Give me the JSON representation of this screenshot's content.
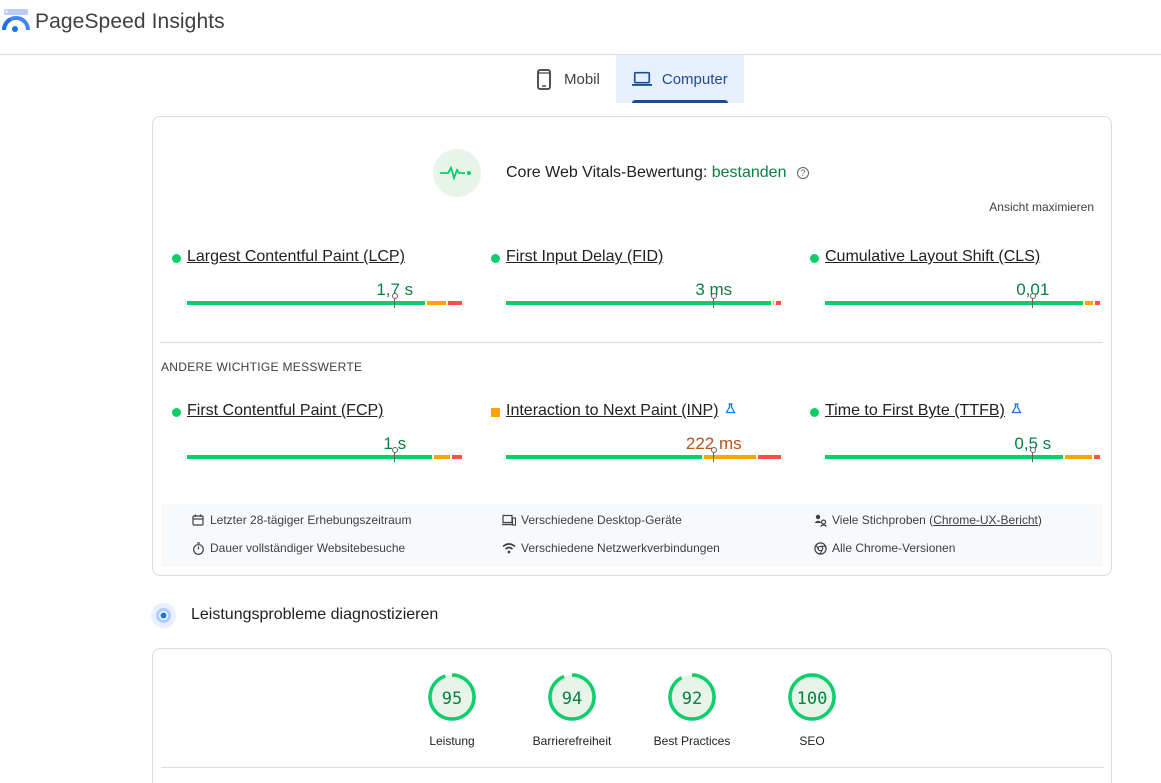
{
  "app": {
    "title": "PageSpeed Insights"
  },
  "tabs": [
    {
      "label": "Mobil",
      "icon": "smartphone-icon",
      "active": false
    },
    {
      "label": "Computer",
      "icon": "laptop-icon",
      "active": true
    }
  ],
  "cwv": {
    "title_prefix": "Core Web Vitals-Bewertung:",
    "status": "bestanden",
    "expand_label": "Ansicht maximieren",
    "core_metrics": [
      {
        "name": "Largest Contentful Paint (LCP)",
        "value": "1,7 s",
        "rating": "good",
        "marker": 0.75,
        "segments": [
          0.867,
          0.075,
          0.058
        ]
      },
      {
        "name": "First Input Delay (FID)",
        "value": "3 ms",
        "rating": "good",
        "marker": 0.75,
        "segments": [
          0.965,
          0.011,
          0.024
        ]
      },
      {
        "name": "Cumulative Layout Shift (CLS)",
        "value": "0,01",
        "rating": "good",
        "marker": 0.75,
        "segments": [
          0.939,
          0.035,
          0.026
        ]
      }
    ],
    "other_label": "ANDERE WICHTIGE MESSWERTE",
    "other_metrics": [
      {
        "name": "First Contentful Paint (FCP)",
        "value": "1 s",
        "rating": "good",
        "marker": 0.75,
        "segments": [
          0.892,
          0.065,
          0.043
        ],
        "experimental": false
      },
      {
        "name": "Interaction to Next Paint (INP)",
        "value": "222 ms",
        "rating": "needs-improvement",
        "marker": 0.75,
        "segments": [
          0.715,
          0.195,
          0.09
        ],
        "experimental": true
      },
      {
        "name": "Time to First Byte (TTFB)",
        "value": "0,5 s",
        "rating": "good",
        "marker": 0.75,
        "segments": [
          0.867,
          0.105,
          0.028
        ],
        "experimental": true
      }
    ],
    "info": {
      "period": "Letzter 28-tägiger Erhebungszeitraum",
      "visit_duration": "Dauer vollständiger Websitebesuche",
      "devices": "Verschiedene Desktop-Geräte",
      "network": "Verschiedene Netzwerkverbindungen",
      "samples_prefix": "Viele Stichproben (",
      "samples_link": "Chrome-UX-Bericht",
      "samples_suffix": ")",
      "chrome_versions": "Alle Chrome-Versionen"
    }
  },
  "diagnose": {
    "title": "Leistungsprobleme diagnostizieren",
    "scores": [
      {
        "label": "Leistung",
        "score": 95
      },
      {
        "label": "Barrierefreiheit",
        "score": 94
      },
      {
        "label": "Best Practices",
        "score": 92
      },
      {
        "label": "SEO",
        "score": 100
      }
    ]
  },
  "colors": {
    "good": "#0cce6b",
    "average": "#ffa400",
    "poor": "#ff4e42",
    "good_text": "#0b8043",
    "accent": "#1a4c9a"
  }
}
